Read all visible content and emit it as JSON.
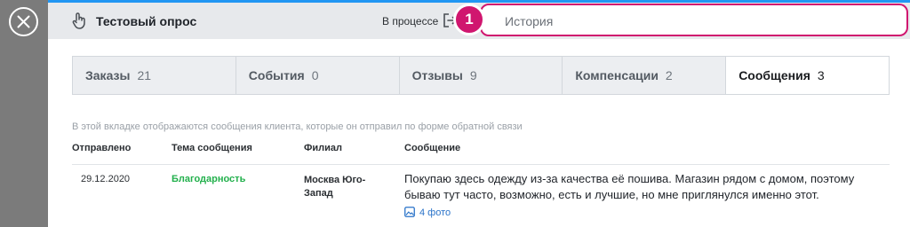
{
  "header": {
    "title": "Тестовый опрос",
    "status": "В процессе",
    "history_label": "История",
    "step_number": "1"
  },
  "tabs": [
    {
      "label": "Заказы",
      "count": "21"
    },
    {
      "label": "События",
      "count": "0"
    },
    {
      "label": "Отзывы",
      "count": "9"
    },
    {
      "label": "Компенсации",
      "count": "2"
    },
    {
      "label": "Сообщения",
      "count": "3"
    }
  ],
  "messages": {
    "hint": "В этой вкладке отображаются сообщения клиента, которые он отправил по форме обратной связи",
    "columns": {
      "sent": "Отправлено",
      "topic": "Тема сообщения",
      "branch": "Филиал",
      "message": "Сообщение"
    },
    "rows": [
      {
        "date": "29.12.2020",
        "topic": "Благодарность",
        "branch": "Москва Юго-Запад",
        "message": "Покупаю здесь одежду из-за качества её пошива. Магазин рядом с домом, поэтому бываю тут часто, возможно, есть и лучшие, но мне приглянулся именно этот.",
        "photos": "4 фото"
      }
    ]
  },
  "colors": {
    "accent": "#d0166f",
    "top_bar": "#2196f3",
    "topic_green": "#22b04c",
    "link_blue": "#2a73c9"
  }
}
